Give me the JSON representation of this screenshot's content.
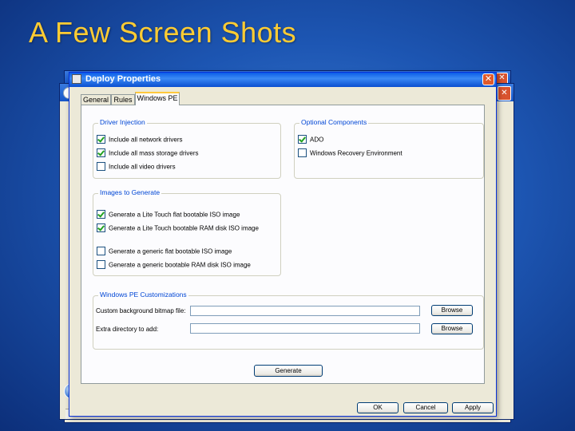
{
  "slide": {
    "title": "A Few Screen Shots"
  },
  "dialog": {
    "title": "Deploy Properties",
    "close_label": "✕",
    "tabs": [
      {
        "label": "General",
        "active": false
      },
      {
        "label": "Rules",
        "active": false
      },
      {
        "label": "Windows PE",
        "active": true
      }
    ],
    "groups": {
      "driver_injection": {
        "legend": "Driver Injection",
        "items": [
          {
            "label": "Include all network drivers",
            "checked": true
          },
          {
            "label": "Include all mass storage drivers",
            "checked": true
          },
          {
            "label": "Include all video drivers",
            "checked": false
          }
        ]
      },
      "optional_components": {
        "legend": "Optional Components",
        "items": [
          {
            "label": "ADO",
            "checked": true
          },
          {
            "label": "Windows Recovery Environment",
            "checked": false
          }
        ]
      },
      "images_to_generate": {
        "legend": "Images to Generate",
        "items": [
          {
            "label": "Generate a Lite Touch flat bootable ISO image",
            "checked": true
          },
          {
            "label": "Generate a Lite Touch bootable RAM disk ISO image",
            "checked": true
          },
          {
            "label": "Generate a generic flat bootable ISO image",
            "checked": false
          },
          {
            "label": "Generate a generic bootable RAM disk ISO image",
            "checked": false
          }
        ]
      },
      "customizations": {
        "legend": "Windows PE Customizations",
        "background_label": "Custom background bitmap file:",
        "background_value": "",
        "extra_dir_label": "Extra directory to add:",
        "extra_dir_value": "",
        "browse_label": "Browse"
      }
    },
    "generate_label": "Generate",
    "footer": {
      "ok_label": "OK",
      "cancel_label": "Cancel",
      "apply_label": "Apply"
    }
  },
  "background_windows": {
    "close_label": "✕"
  }
}
